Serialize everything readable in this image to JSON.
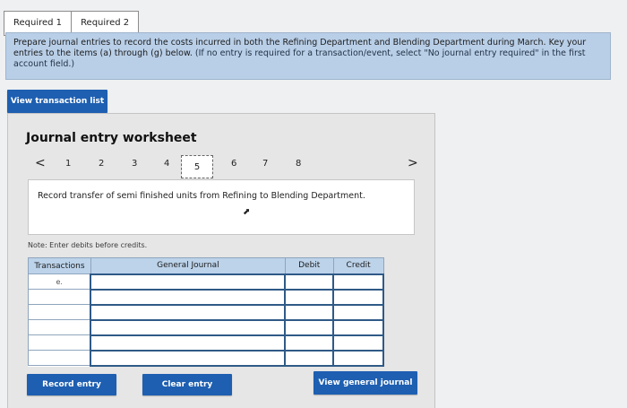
{
  "tabs": [
    "Required 1",
    "Required 2"
  ],
  "instructions": {
    "main": "Prepare journal entries to record the costs incurred in both the Refining Department and Blending Department during March. Key your entries to the items (a) through (g) below.",
    "hint": "(If no entry is required for a transaction/event, select \"No journal entry required\" in the first account field.)"
  },
  "buttons": {
    "view_transaction_list": "View transaction list",
    "record_entry": "Record entry",
    "clear_entry": "Clear entry",
    "view_general_journal": "View general journal"
  },
  "worksheet": {
    "title": "Journal entry worksheet",
    "pages": [
      "1",
      "2",
      "3",
      "4",
      "5",
      "6",
      "7",
      "8"
    ],
    "current_page": "5",
    "prev_icon": "<",
    "next_icon": ">",
    "description": "Record transfer of semi finished units from Refining to Blending Department.",
    "note": "Note: Enter debits before credits.",
    "columns": [
      "Transactions",
      "General Journal",
      "Debit",
      "Credit"
    ],
    "rows": [
      {
        "transaction": "e."
      },
      {
        "transaction": ""
      },
      {
        "transaction": ""
      },
      {
        "transaction": ""
      },
      {
        "transaction": ""
      },
      {
        "transaction": ""
      }
    ]
  }
}
